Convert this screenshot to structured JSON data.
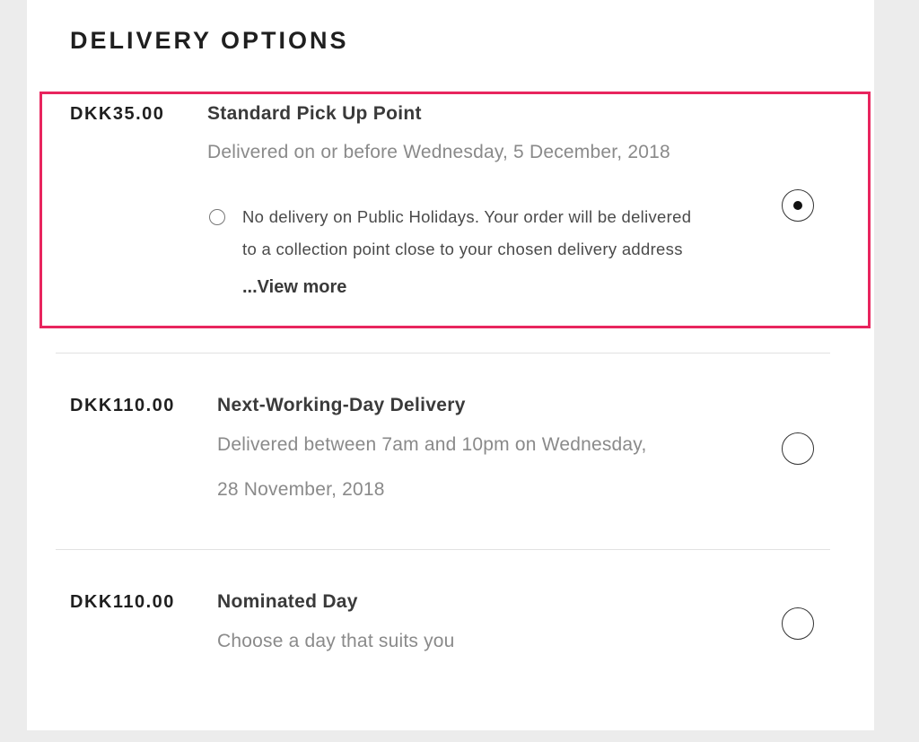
{
  "heading": "DELIVERY OPTIONS",
  "options": [
    {
      "price": "DKK35.00",
      "name": "Standard Pick Up Point",
      "description_lines": [
        "Delivered on or before Wednesday, 5 December, 2018"
      ],
      "note_lines": [
        "No delivery on Public Holidays. Your order will be delivered",
        "to a collection point close to your chosen delivery address"
      ],
      "view_more": "...View more",
      "selected": true
    },
    {
      "price": "DKK110.00",
      "name": "Next-Working-Day Delivery",
      "description_lines": [
        "Delivered between 7am and 10pm on Wednesday,",
        "28 November, 2018"
      ],
      "selected": false
    },
    {
      "price": "DKK110.00",
      "name": "Nominated Day",
      "description_lines": [
        "Choose a day that suits you"
      ],
      "selected": false
    }
  ],
  "colors": {
    "highlight_border": "#e8255e",
    "background": "#ececec",
    "panel": "#ffffff"
  }
}
